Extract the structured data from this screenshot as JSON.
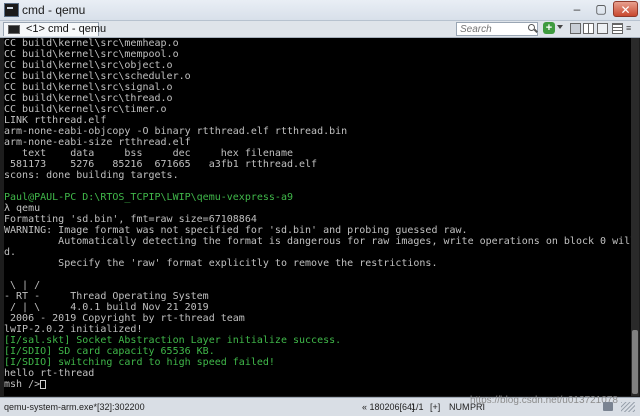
{
  "window": {
    "title": "cmd - qemu",
    "controls": {
      "minimize": "–",
      "maximize": "▢",
      "close": "✕"
    }
  },
  "tabbar": {
    "tab_label": "<1> cmd - qemu",
    "search_placeholder": "Search",
    "add_label": "+",
    "more_label": "≡"
  },
  "console": {
    "lines": [
      {
        "text": "CC build\\kernel\\src\\memheap.o",
        "color": "default"
      },
      {
        "text": "CC build\\kernel\\src\\mempool.o",
        "color": "default"
      },
      {
        "text": "CC build\\kernel\\src\\object.o",
        "color": "default"
      },
      {
        "text": "CC build\\kernel\\src\\scheduler.o",
        "color": "default"
      },
      {
        "text": "CC build\\kernel\\src\\signal.o",
        "color": "default"
      },
      {
        "text": "CC build\\kernel\\src\\thread.o",
        "color": "default"
      },
      {
        "text": "CC build\\kernel\\src\\timer.o",
        "color": "default"
      },
      {
        "text": "LINK rtthread.elf",
        "color": "default"
      },
      {
        "text": "arm-none-eabi-objcopy -O binary rtthread.elf rtthread.bin",
        "color": "default"
      },
      {
        "text": "arm-none-eabi-size rtthread.elf",
        "color": "default"
      },
      {
        "text": "   text    data     bss     dec     hex filename",
        "color": "default"
      },
      {
        "text": " 581173    5276   85216  671665   a3fb1 rtthread.elf",
        "color": "default"
      },
      {
        "text": "scons: done building targets.",
        "color": "default"
      },
      {
        "text": "",
        "color": "default"
      },
      {
        "text": "Paul@PAUL-PC D:\\RTOS_TCPIP\\LWIP\\qemu-vexpress-a9",
        "color": "green"
      },
      {
        "text": "λ qemu",
        "color": "default"
      },
      {
        "text": "Formatting 'sd.bin', fmt=raw size=67108864",
        "color": "default"
      },
      {
        "text": "WARNING: Image format was not specified for 'sd.bin' and probing guessed raw.",
        "color": "default"
      },
      {
        "text": "         Automatically detecting the format is dangerous for raw images, write operations on block 0 will be restricte",
        "color": "default"
      },
      {
        "text": "d.",
        "color": "default"
      },
      {
        "text": "         Specify the 'raw' format explicitly to remove the restrictions.",
        "color": "default"
      },
      {
        "text": "",
        "color": "default"
      },
      {
        "text": " \\ | /",
        "color": "default"
      },
      {
        "text": "- RT -     Thread Operating System",
        "color": "default"
      },
      {
        "text": " / | \\     4.0.1 build Nov 21 2019",
        "color": "default"
      },
      {
        "text": " 2006 - 2019 Copyright by rt-thread team",
        "color": "default"
      },
      {
        "text": "lwIP-2.0.2 initialized!",
        "color": "default"
      },
      {
        "text": "[I/sal.skt] Socket Abstraction Layer initialize success.",
        "color": "green"
      },
      {
        "text": "[I/SDIO] SD card capacity 65536 KB.",
        "color": "green"
      },
      {
        "text": "[I/SDIO] switching card to high speed failed!",
        "color": "green"
      },
      {
        "text": "hello rt-thread",
        "color": "default"
      },
      {
        "text": "msh />",
        "color": "default"
      }
    ]
  },
  "statusbar": {
    "process": "qemu-system-arm.exe*[32]:302200",
    "position": "« 180206[64]",
    "selection": "1/1",
    "mode": "[+]",
    "num": "NUM",
    "priority": "PRI",
    "watermark": "https://blog.csdn.net/u013721078"
  },
  "colors": {
    "default_text": "#c0c0c0",
    "green_text": "#40b84a",
    "console_bg": "#000000"
  }
}
